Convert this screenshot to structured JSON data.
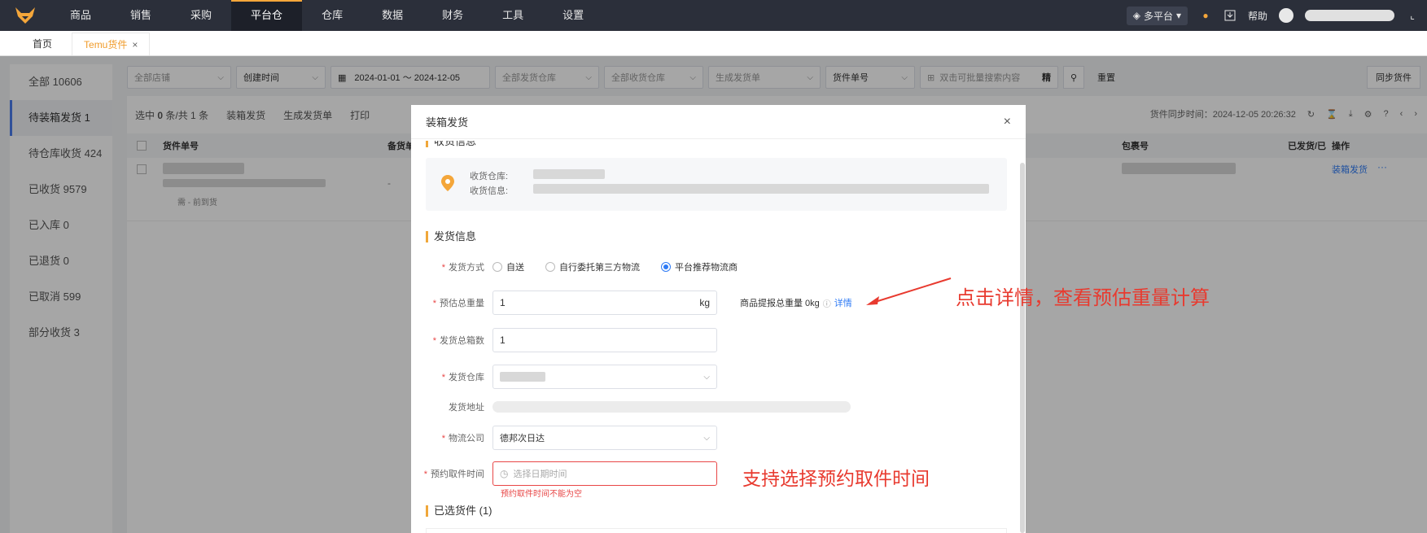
{
  "topnav": {
    "items": [
      "商品",
      "销售",
      "采购",
      "平台仓",
      "仓库",
      "数据",
      "财务",
      "工具",
      "设置"
    ],
    "active_index": 3,
    "multi_platform": "多平台",
    "help": "帮助"
  },
  "tabs": [
    {
      "label": "首页",
      "active": false
    },
    {
      "label": "Temu货件",
      "active": true,
      "close": "×"
    }
  ],
  "sidebar": {
    "items": [
      {
        "label": "全部",
        "count": "10606"
      },
      {
        "label": "待装箱发货",
        "count": "1"
      },
      {
        "label": "待仓库收货",
        "count": "424"
      },
      {
        "label": "已收货",
        "count": "9579"
      },
      {
        "label": "已入库",
        "count": "0"
      },
      {
        "label": "已退货",
        "count": "0"
      },
      {
        "label": "已取消",
        "count": "599"
      },
      {
        "label": "部分收货",
        "count": "3"
      }
    ],
    "active_index": 1
  },
  "filters": {
    "store": "全部店铺",
    "date_type": "创建时间",
    "date_range": "2024-01-01 ～ 2024-12-05",
    "ship_warehouse": "全部发货仓库",
    "recv_warehouse": "全部收货仓库",
    "gen_order": "生成发货单",
    "shipment_no": "货件单号",
    "search_placeholder": "双击可批量搜索内容",
    "exact": "精",
    "reset": "重置",
    "sync": "同步货件"
  },
  "toolbar": {
    "selected_prefix": "选中",
    "selected_count": "0",
    "selected_suffix": "条/共 1 条",
    "pack_ship": "装箱发货",
    "gen_ship_order": "生成发货单",
    "print": "打印",
    "sync_time": "货件同步时间：2024-12-05 20:26:32"
  },
  "table": {
    "columns": [
      "货件单号",
      "备货单",
      "包裹号",
      "已发货/已",
      "操作"
    ],
    "row": {
      "note": "需 - 前到货",
      "dash": "-",
      "action": "装箱发货",
      "more": "···"
    }
  },
  "modal": {
    "title": "装箱发货",
    "close": "×",
    "recv_section_partial": "收货信息",
    "recv_warehouse_label": "收货仓库:",
    "recv_info_label": "收货信息:",
    "ship_section": "发货信息",
    "ship_method_label": "发货方式",
    "ship_methods": [
      "自送",
      "自行委托第三方物流",
      "平台推荐物流商"
    ],
    "ship_method_selected": 2,
    "weight_label": "预估总重量",
    "weight_value": "1",
    "weight_unit": "kg",
    "weight_hint": "商品提报总重量 0kg",
    "detail_link": "详情",
    "boxes_label": "发货总箱数",
    "boxes_value": "1",
    "warehouse_label": "发货仓库",
    "address_label": "发货地址",
    "carrier_label": "物流公司",
    "carrier_value": "德邦次日达",
    "pickup_label": "预约取件时间",
    "pickup_placeholder": "选择日期时间",
    "pickup_error": "预约取件时间不能为空",
    "selected_section": "已选货件 (1)"
  },
  "annotations": {
    "detail_note": "点击详情，查看预估重量计算",
    "pickup_note": "支持选择预约取件时间"
  },
  "colors": {
    "accent": "#f09b2a",
    "topbar": "#2b2f3a",
    "link": "#2f7bf5",
    "error": "#e84646",
    "annotation": "#e83a2f"
  }
}
